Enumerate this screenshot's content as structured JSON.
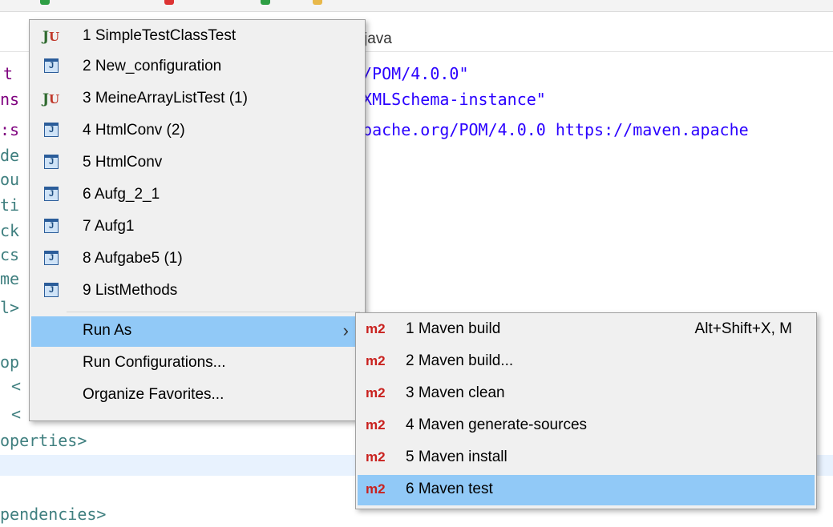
{
  "editor": {
    "tab_title": "java",
    "line1": "g/POM/4.0.0\"",
    "line2": "/XMLSchema-instance\"",
    "line3": "apache.org/POM/4.0.0 https://maven.apache",
    "frag_t": "t",
    "frag_ns": "ns",
    "frag_s": ":s",
    "frag_de": "de",
    "frag_ou": "ou",
    "frag_ti": "ti",
    "frag_ck": "ck",
    "frag_cs": "cs",
    "frag_me": "me",
    "frag_l": "l>",
    "frag_op": "op",
    "frag_lt": "<",
    "frag_lt2": "<",
    "line_properties_close": "operties>",
    "line_dependencies": "pendencies>",
    "frag_gt": ">"
  },
  "favorites_menu": {
    "items": [
      {
        "num": "1",
        "label": "SimpleTestClassTest",
        "icon": "junit-icon"
      },
      {
        "num": "2",
        "label": "New_configuration",
        "icon": "java-app-icon"
      },
      {
        "num": "3",
        "label": "MeineArrayListTest (1)",
        "icon": "junit-icon"
      },
      {
        "num": "4",
        "label": "HtmlConv (2)",
        "icon": "java-app-icon"
      },
      {
        "num": "5",
        "label": "HtmlConv",
        "icon": "java-app-icon"
      },
      {
        "num": "6",
        "label": "Aufg_2_1",
        "icon": "java-app-icon"
      },
      {
        "num": "7",
        "label": "Aufg1",
        "icon": "java-app-icon"
      },
      {
        "num": "8",
        "label": "Aufgabe5 (1)",
        "icon": "java-app-icon"
      },
      {
        "num": "9",
        "label": "ListMethods",
        "icon": "java-app-icon"
      }
    ],
    "run_as": "Run As",
    "run_configurations": "Run Configurations...",
    "organize_favorites": "Organize Favorites..."
  },
  "run_as_menu": {
    "icon_text": "m2",
    "items": [
      {
        "label": "1 Maven build",
        "accelerator": "Alt+Shift+X, M"
      },
      {
        "label": "2 Maven build..."
      },
      {
        "label": "3 Maven clean"
      },
      {
        "label": "4 Maven generate-sources"
      },
      {
        "label": "5 Maven install"
      },
      {
        "label": "6 Maven test"
      }
    ]
  },
  "colors": {
    "menu_bg": "#f0f0f0",
    "hover": "#91c9f7",
    "m2_red": "#c9211e",
    "code_blue": "#2a00ff",
    "tag_teal": "#3f7f7f"
  }
}
